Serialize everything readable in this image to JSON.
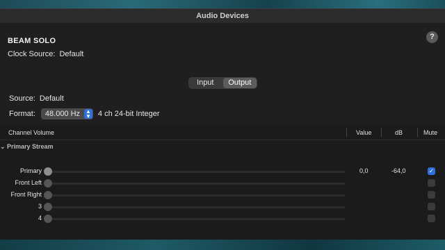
{
  "window": {
    "title": "Audio Devices"
  },
  "device": {
    "name": "BEAM SOLO",
    "clock_label": "Clock Source:",
    "clock_value": "Default",
    "help_label": "?"
  },
  "tabs": [
    {
      "label": "Input",
      "active": false
    },
    {
      "label": "Output",
      "active": true
    }
  ],
  "source": {
    "label": "Source:",
    "value": "Default"
  },
  "format": {
    "label": "Format:",
    "rate": "48.000 Hz",
    "description": "4 ch 24-bit Integer"
  },
  "table": {
    "headers": {
      "channel": "Channel Volume",
      "value": "Value",
      "db": "dB",
      "mute": "Mute"
    },
    "group": "Primary Stream",
    "rows": [
      {
        "name": "Primary",
        "value": "0,0",
        "db": "-64,0",
        "muted": true
      },
      {
        "name": "Front Left",
        "value": "",
        "db": "",
        "muted": false
      },
      {
        "name": "Front Right",
        "value": "",
        "db": "",
        "muted": false
      },
      {
        "name": "3",
        "value": "",
        "db": "",
        "muted": false
      },
      {
        "name": "4",
        "value": "",
        "db": "",
        "muted": false
      }
    ]
  },
  "colors": {
    "accent": "#2f6fe0",
    "window_bg": "#1f1f1f"
  }
}
